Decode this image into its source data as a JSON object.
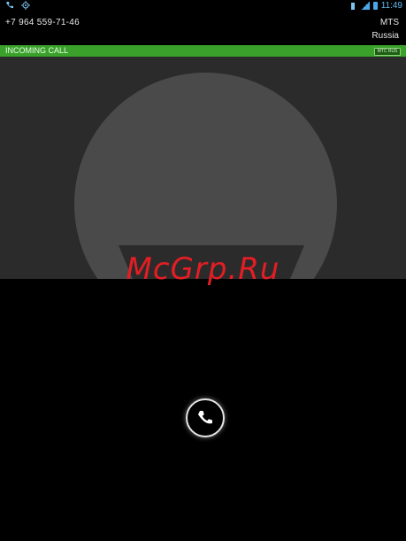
{
  "status_bar": {
    "time": "11:49",
    "left_icons": [
      "phone-icon",
      "gps-icon"
    ],
    "right_icons": [
      "vibrate-icon",
      "signal-icon",
      "battery-icon"
    ]
  },
  "caller": {
    "number": "+7 964 559-71-46",
    "carrier": "MTS",
    "country": "Russia"
  },
  "incoming": {
    "label": "INCOMING CALL",
    "sim_badge": "МТС RUS"
  },
  "watermark": "McGrp.Ru",
  "colors": {
    "incoming_bar": "#3aa12a",
    "photo_bg": "#2b2b2b",
    "avatar": "#4a4a4a",
    "watermark": "#e31e24"
  },
  "answer": {
    "icon": "phone-icon"
  }
}
